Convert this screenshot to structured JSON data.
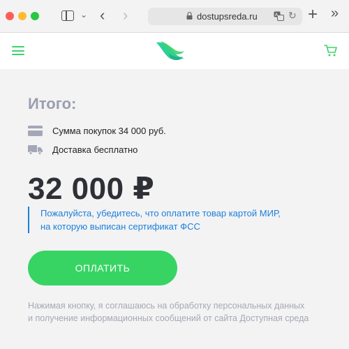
{
  "browser": {
    "url": "dostupsreda.ru",
    "icons": [
      "sidebar-icon",
      "chevron-down-icon",
      "back-icon",
      "forward-icon",
      "lock-icon",
      "translate-icon",
      "reload-icon",
      "plus-icon",
      "double-chevron-icon"
    ]
  },
  "header": {
    "icons": [
      "menu-icon",
      "logo",
      "cart-icon"
    ],
    "accent_color": "#3dd36b"
  },
  "summary": {
    "title": "Итого:",
    "purchase_sum": "Сумма покупок 34 000 руб.",
    "delivery": "Доставка бесплатно",
    "total_price": "32 000 ₽"
  },
  "notice": {
    "line1": "Пожалуйста, убедитесь, что оплатите товар картой МИР,",
    "line2": "на которую выписан сертификат ФСС",
    "color": "#1c7fd8"
  },
  "pay_button": {
    "label": "ОПЛАТИТЬ",
    "color": "#37d463"
  },
  "consent": {
    "line1": "Нажимая кнопку, я соглашаюсь на обработку персональных данных",
    "line2": "и получение информационных сообщений от сайта Доступная среда"
  }
}
